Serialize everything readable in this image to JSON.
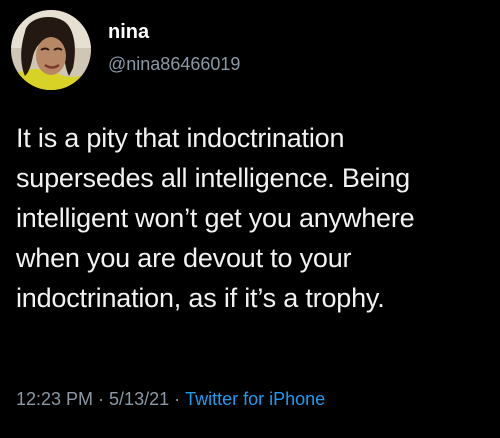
{
  "tweet": {
    "author": {
      "display_name": "nina",
      "handle": "@nina86466019",
      "avatar_icon": "profile-photo"
    },
    "text_lines": [
      "It is a pity that indoctrination",
      "supersedes all intelligence. Being",
      "intelligent won’t get you anywhere",
      "when you are devout to your",
      "indoctrination, as if it’s a trophy."
    ],
    "time": "12:23 PM",
    "separator": "·",
    "date": "5/13/21",
    "source": "Twitter for iPhone"
  },
  "colors": {
    "background": "#000000",
    "text": "#f2f2f2",
    "secondary": "#8b98a5",
    "link": "#1d9bf0"
  }
}
